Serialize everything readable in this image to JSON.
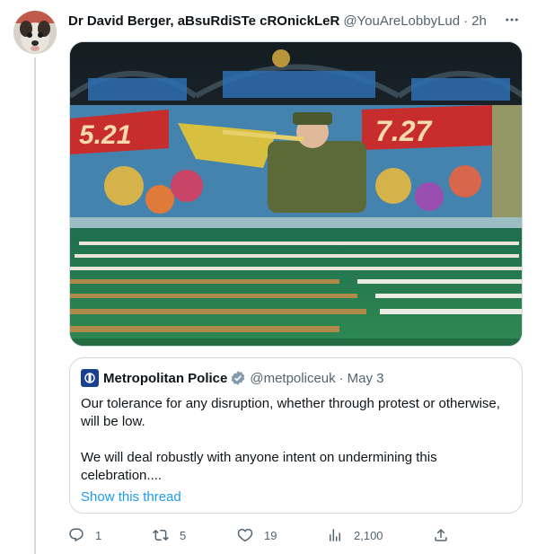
{
  "tweet": {
    "author_name": "Dr David Berger, aBsuRdiSTe cROnickLeR",
    "handle": "@YouAreLobbyLud",
    "separator": "·",
    "time": "2h",
    "more_icon": "more-dots-icon",
    "media": {
      "banner_left": "5.21",
      "banner_right": "7.27"
    }
  },
  "quote": {
    "author_name": "Metropolitan Police",
    "handle": "@metpoliceuk",
    "separator": "·",
    "time": "May 3",
    "paragraph_1": "Our tolerance for any disruption, whether through protest or otherwise, will be low.",
    "paragraph_2": "We will deal robustly with anyone intent on undermining this celebration....",
    "show_thread": "Show this thread"
  },
  "actions": {
    "reply": {
      "icon": "reply-icon",
      "count": "1"
    },
    "retweet": {
      "icon": "retweet-icon",
      "count": "5"
    },
    "like": {
      "icon": "heart-icon",
      "count": "19"
    },
    "views": {
      "icon": "analytics-icon",
      "count": "2,100"
    },
    "share": {
      "icon": "share-icon"
    }
  },
  "colors": {
    "text": "#0f1419",
    "muted": "#536471",
    "link": "#1d9bf0",
    "border": "#cfd9de"
  }
}
